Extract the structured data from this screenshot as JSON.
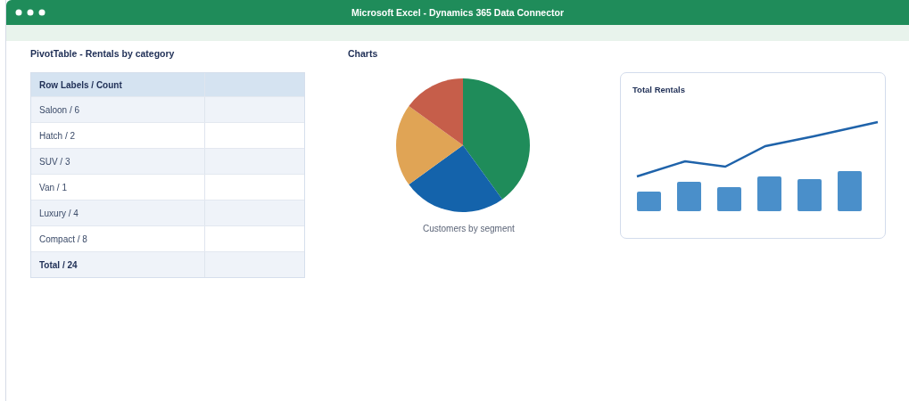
{
  "window": {
    "title": "Microsoft Excel - Dynamics 365 Data Connector"
  },
  "pivot": {
    "title": "PivotTable - Rentals by category",
    "header": "Row Labels / Count",
    "rows": [
      {
        "label": "Saloon / 6",
        "kind": "item"
      },
      {
        "label": "Hatch / 2",
        "kind": "item"
      },
      {
        "label": "SUV / 3",
        "kind": "item"
      },
      {
        "label": "Van / 1",
        "kind": "item"
      },
      {
        "label": "Luxury / 4",
        "kind": "item"
      },
      {
        "label": "Compact / 8",
        "kind": "item"
      },
      {
        "label": "Total / 24",
        "kind": "total"
      }
    ]
  },
  "charts": {
    "title": "Charts",
    "pie_caption": "Customers by segment",
    "card_title": "Total Rentals"
  }
}
